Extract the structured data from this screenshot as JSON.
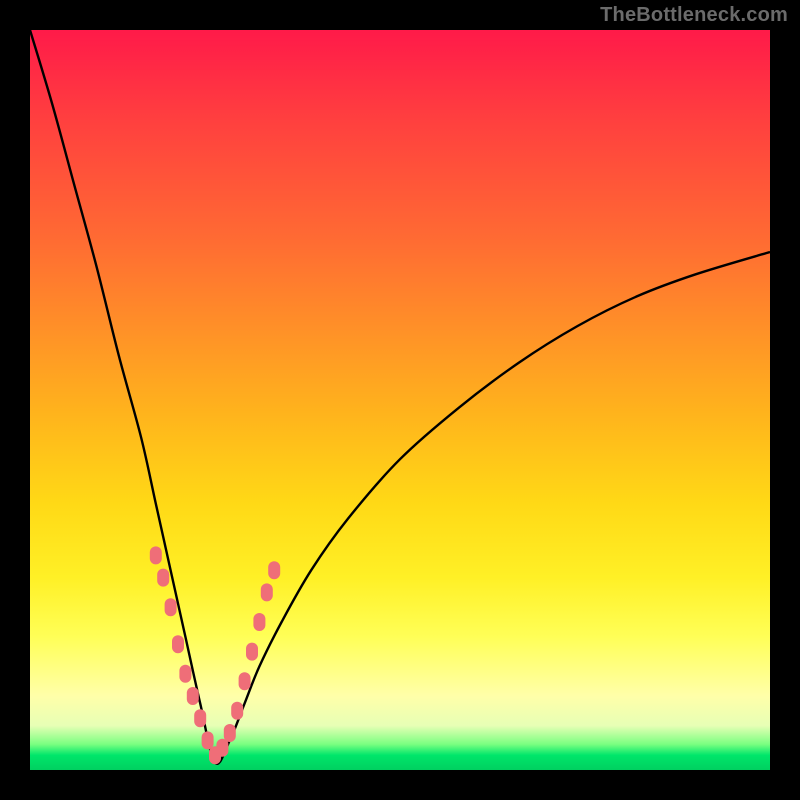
{
  "watermark": "TheBottleneck.com",
  "colors": {
    "frame": "#000000",
    "gradient_top": "#ff1a49",
    "gradient_mid": "#ffd916",
    "gradient_bottom": "#00d060",
    "curve": "#000000",
    "markers": "#ef6e78"
  },
  "chart_data": {
    "type": "line",
    "title": "",
    "xlabel": "",
    "ylabel": "",
    "xlim": [
      0,
      100
    ],
    "ylim": [
      0,
      100
    ],
    "note": "V-shaped bottleneck curve; vertex near x≈25 at y≈0. Left branch steep to top-left corner, right branch rises more gradually toward upper right (~y≈70 at x=100). Discrete salmon markers cluster on both branches near the vertex (roughly y between 3 and 28).",
    "series": [
      {
        "name": "bottleneck-curve",
        "x": [
          0,
          3,
          6,
          9,
          12,
          15,
          17,
          19,
          21,
          23,
          25,
          27,
          29,
          31,
          34,
          38,
          43,
          50,
          58,
          66,
          74,
          82,
          90,
          100
        ],
        "y": [
          100,
          90,
          79,
          68,
          56,
          45,
          36,
          27,
          18,
          9,
          1,
          4,
          9,
          14,
          20,
          27,
          34,
          42,
          49,
          55,
          60,
          64,
          67,
          70
        ]
      }
    ],
    "markers": [
      {
        "x": 17,
        "y": 29
      },
      {
        "x": 18,
        "y": 26
      },
      {
        "x": 19,
        "y": 22
      },
      {
        "x": 20,
        "y": 17
      },
      {
        "x": 21,
        "y": 13
      },
      {
        "x": 22,
        "y": 10
      },
      {
        "x": 23,
        "y": 7
      },
      {
        "x": 24,
        "y": 4
      },
      {
        "x": 25,
        "y": 2
      },
      {
        "x": 26,
        "y": 3
      },
      {
        "x": 27,
        "y": 5
      },
      {
        "x": 28,
        "y": 8
      },
      {
        "x": 29,
        "y": 12
      },
      {
        "x": 30,
        "y": 16
      },
      {
        "x": 31,
        "y": 20
      },
      {
        "x": 32,
        "y": 24
      },
      {
        "x": 33,
        "y": 27
      }
    ]
  }
}
